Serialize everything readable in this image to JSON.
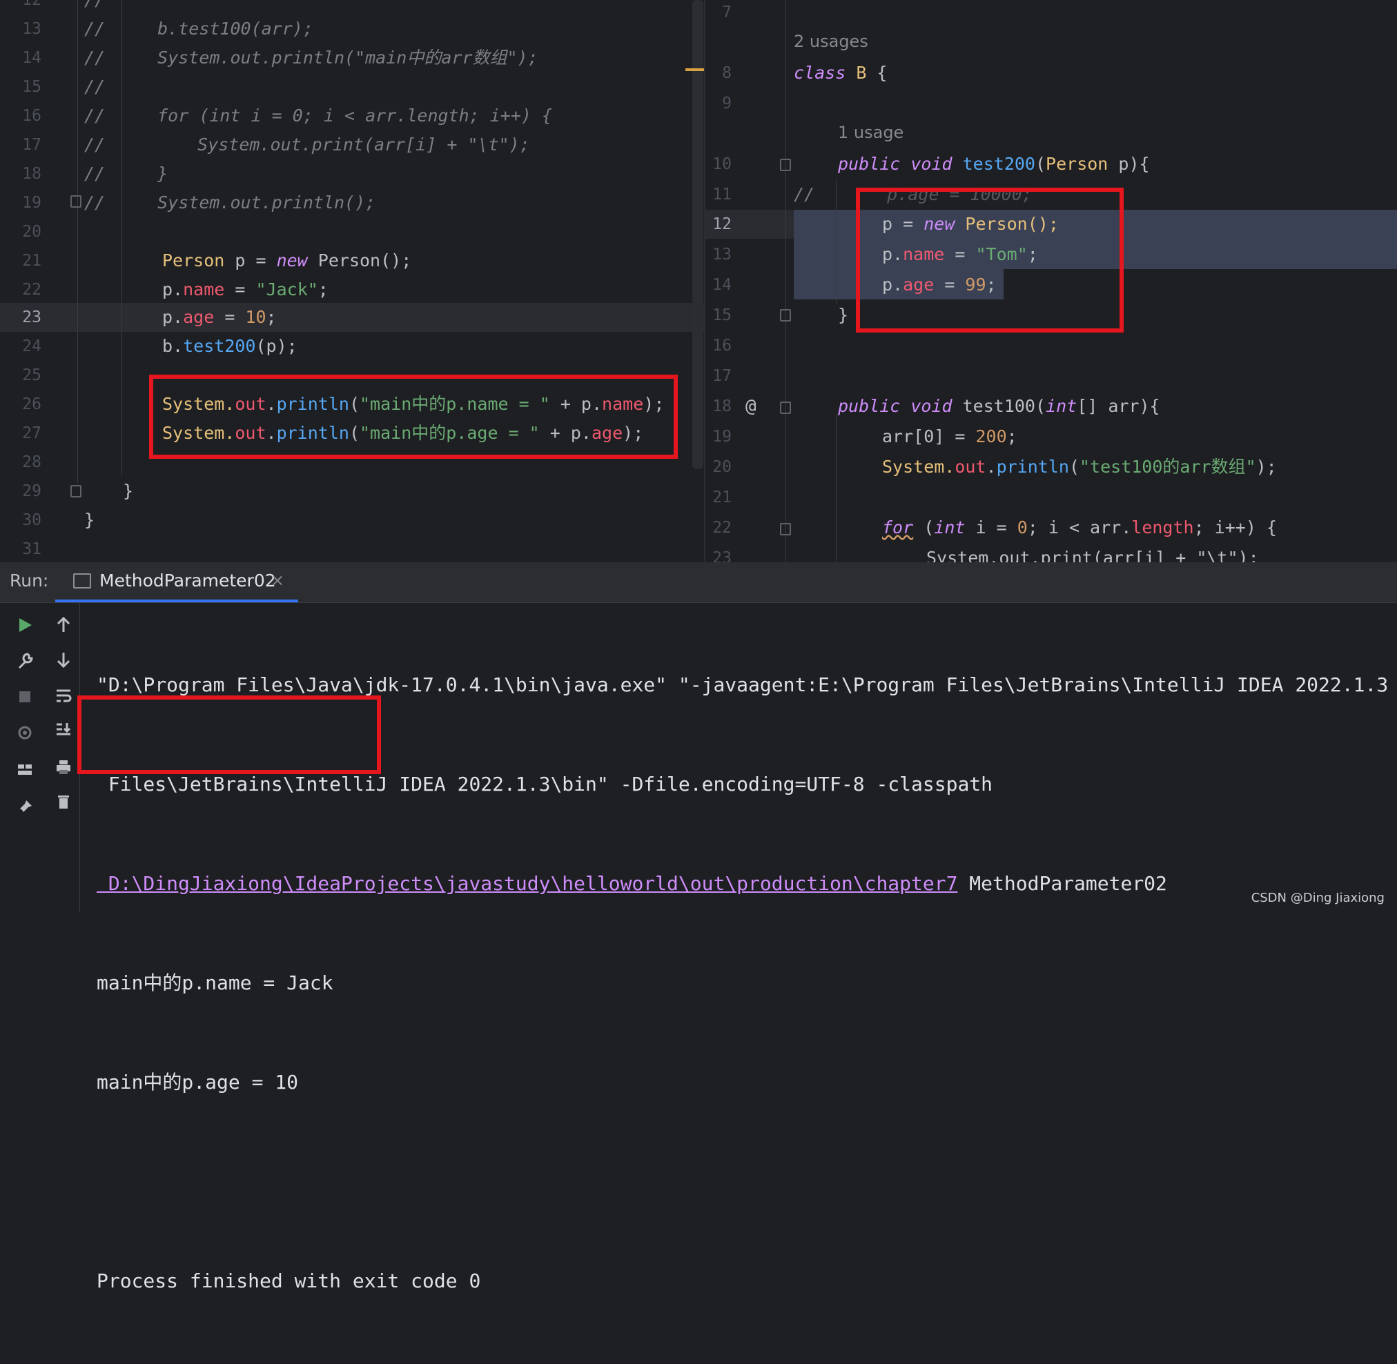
{
  "left_editor": {
    "line_numbers": [
      "12",
      "13",
      "14",
      "15",
      "16",
      "17",
      "18",
      "19",
      "20",
      "21",
      "22",
      "23",
      "24",
      "25",
      "26",
      "27",
      "28",
      "29",
      "30",
      "31"
    ],
    "active_line": "23",
    "lines": {
      "l12": "//",
      "l13a": "//",
      "l13b": "b.test100(arr);",
      "l14a": "//",
      "l14b": "System.out.println(\"main中的arr数组\");",
      "l15a": "//",
      "l16a": "//",
      "l16b": "for (int i = 0; i < arr.length; i++) {",
      "l17a": "//",
      "l17b": "System.out.print(arr[i] + \"\\t\");",
      "l18a": "//",
      "l18b": "}",
      "l19a": "//",
      "l19b": "System.out.println();",
      "l21_type": "Person",
      "l21_p": " p = ",
      "l21_new": "new",
      "l21_rest": " Person();",
      "l22_p": "p.",
      "l22_f": "name",
      "l22_eq": " = ",
      "l22_s": "\"Jack\"",
      "l22_end": ";",
      "l23_p": "p.",
      "l23_f": "age",
      "l23_eq": " = ",
      "l23_n": "10",
      "l23_end": ";",
      "l24_b": "b.",
      "l24_fn": "test200",
      "l24_rest": "(p);",
      "l26_sys": "System.",
      "l26_out": "out",
      "l26_dot": ".",
      "l26_fn": "println",
      "l26_p1": "(",
      "l26_s": "\"main中的p.name = \"",
      "l26_plus": " + p.",
      "l26_f": "name",
      "l26_end": ");",
      "l27_sys": "System.",
      "l27_out": "out",
      "l27_dot": ".",
      "l27_fn": "println",
      "l27_p1": "(",
      "l27_s": "\"main中的p.age = \"",
      "l27_plus": " + p.",
      "l27_f": "age",
      "l27_end": ");",
      "l29": "}",
      "l30": "}"
    }
  },
  "right_editor": {
    "line_numbers": [
      "7",
      "8",
      "9",
      "10",
      "11",
      "12",
      "13",
      "14",
      "15",
      "16",
      "17",
      "18",
      "19",
      "20",
      "21",
      "22",
      "23"
    ],
    "active_line": "12",
    "usages_class": "2 usages",
    "usages_method": "1 usage",
    "lines": {
      "l8_kw": "class",
      "l8_name": " B ",
      "l8_brace": "{",
      "l10_pub": "public",
      "l10_void": " void ",
      "l10_fn": "test200",
      "l10_p": "(",
      "l10_type": "Person",
      "l10_rest": " p){",
      "l11_cm": "//",
      "l11_code": "p.age = 10000;",
      "l12_p": "p = ",
      "l12_new": "new",
      "l12_rest": " Person();",
      "l13_p": "p.",
      "l13_f": "name",
      "l13_eq": " = ",
      "l13_s": "\"Tom\"",
      "l13_end": ";",
      "l14_p": "p.",
      "l14_f": "age",
      "l14_eq": " = ",
      "l14_n": "99",
      "l14_end": ";",
      "l15": "}",
      "l18_pub": "public",
      "l18_void": " void ",
      "l18_fn": "test100(",
      "l18_int": "int",
      "l18_rest": "[] arr){",
      "l19_a": "arr[0] = ",
      "l19_n": "200",
      "l19_end": ";",
      "l20_sys": "System.",
      "l20_out": "out",
      "l20_dot": ".",
      "l20_fn": "println",
      "l20_p": "(",
      "l20_s": "\"test100的arr数组\"",
      "l20_end": ");",
      "l22_for": "for",
      "l22_p1": " (",
      "l22_int": "int",
      "l22_a": " i = ",
      "l22_n": "0",
      "l22_b": "; i < arr.",
      "l22_len": "length",
      "l22_end": "; i++) {",
      "l23": "System.out.print(arr[i] + \"\\t\");"
    },
    "gutter_at": "@"
  },
  "run_panel": {
    "label": "Run:",
    "tab_name": "MethodParameter02",
    "close": "×",
    "console": {
      "line1": "\"D:\\Program Files\\Java\\jdk-17.0.4.1\\bin\\java.exe\" \"-javaagent:E:\\Program Files\\JetBrains\\IntelliJ IDEA 2022.1.3",
      "line2": " Files\\JetBrains\\IntelliJ IDEA 2022.1.3\\bin\" -Dfile.encoding=UTF-8 -classpath",
      "line3_link": " D:\\DingJiaxiong\\IdeaProjects\\javastudy\\helloworld\\out\\production\\chapter7",
      "line3_rest": " MethodParameter02",
      "line4": "main中的p.name = Jack",
      "line5": "main中的p.age = 10",
      "line6": "",
      "line7": "Process finished with exit code 0"
    }
  },
  "watermark": "CSDN @Ding Jiaxiong",
  "colors": {
    "background": "#1e1f22",
    "highlight_box": "#e5161d",
    "accent": "#3574f0"
  }
}
